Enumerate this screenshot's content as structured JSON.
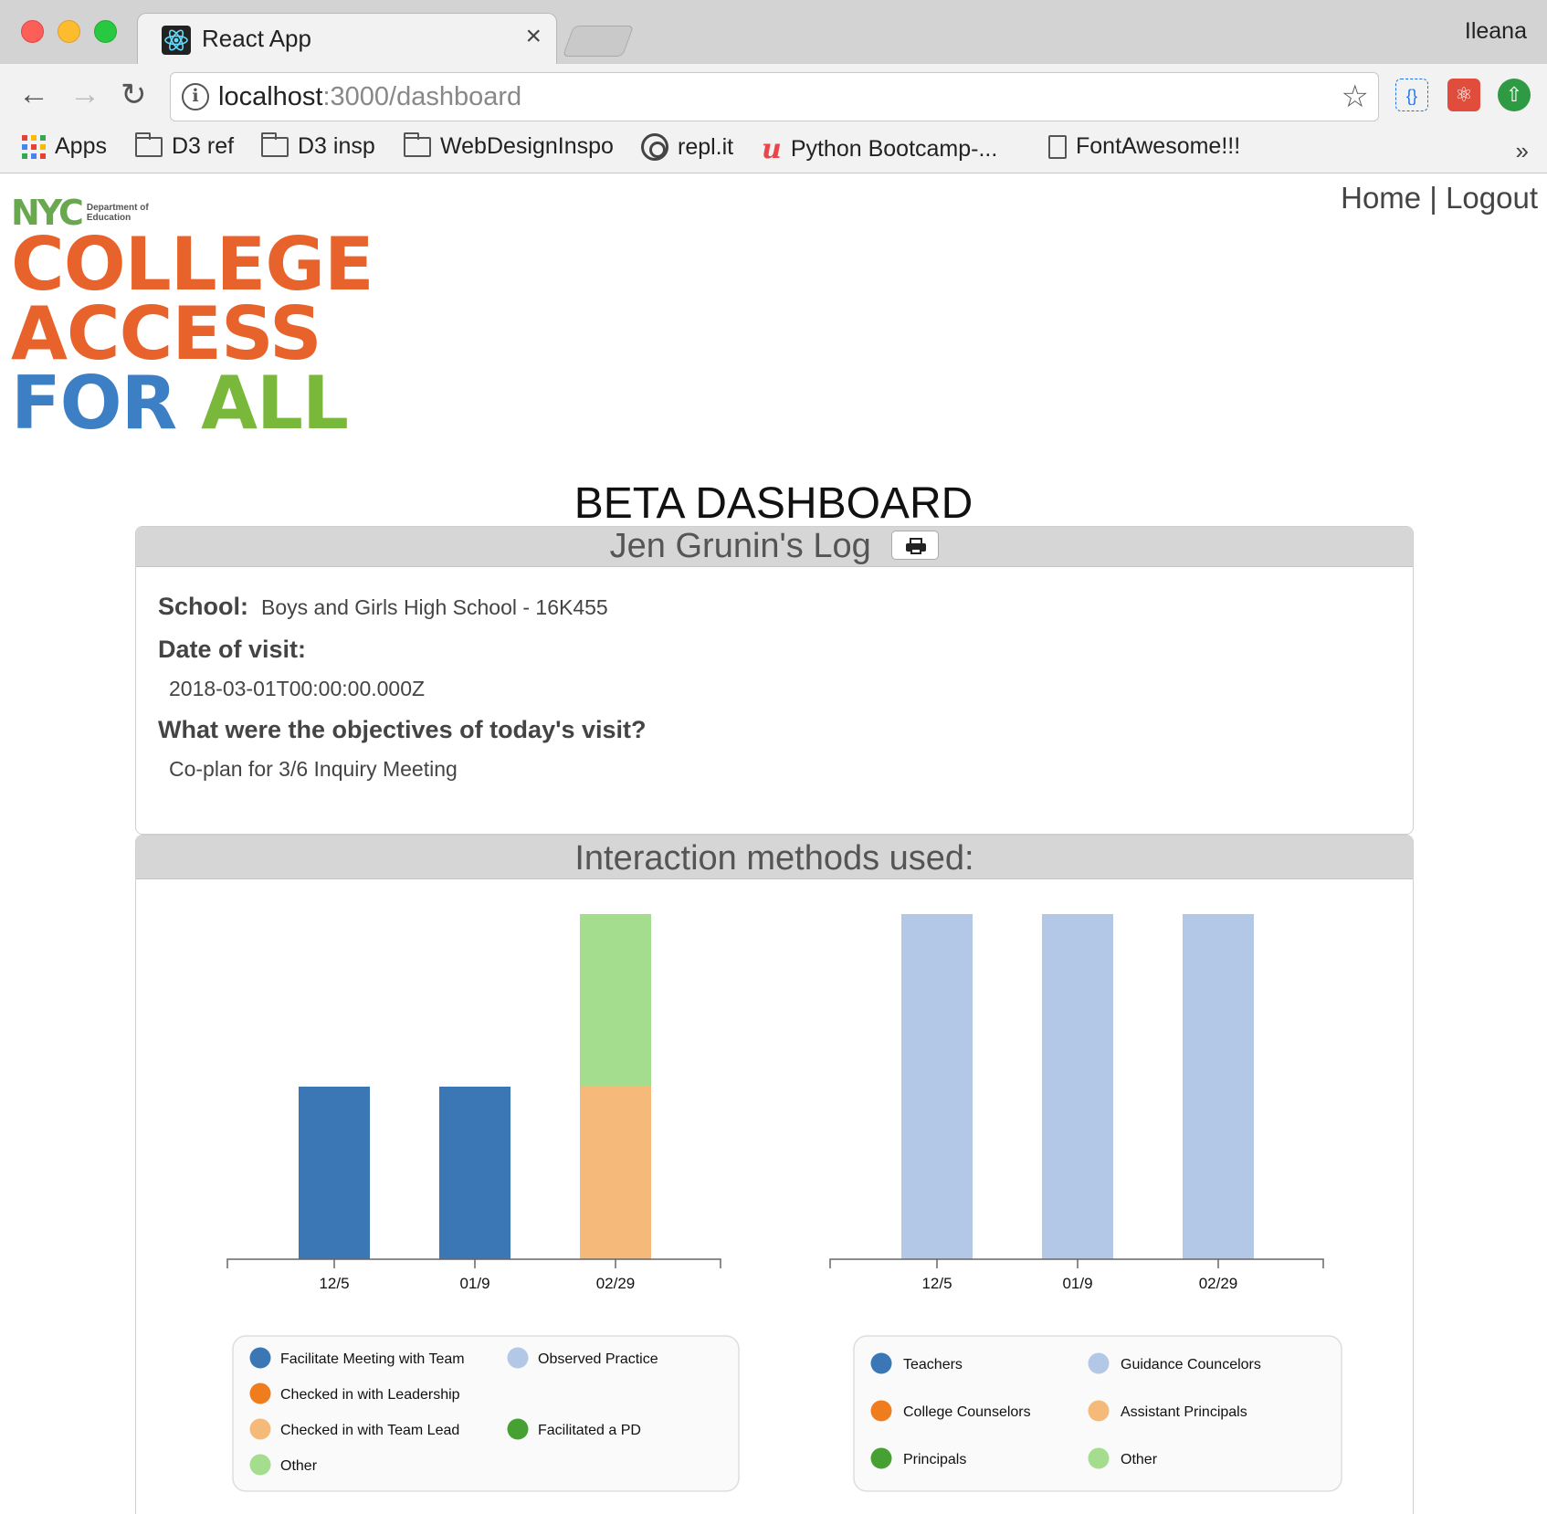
{
  "browser": {
    "tab_title": "React App",
    "tab_close": "×",
    "profile_name": "Ileana",
    "url_host": "localhost",
    "url_path": ":3000/dashboard",
    "bookmarks": [
      {
        "label": "Apps",
        "icon": "apps-grid-icon"
      },
      {
        "label": "D3 ref",
        "icon": "folder-icon"
      },
      {
        "label": "D3 insp",
        "icon": "folder-icon"
      },
      {
        "label": "WebDesignInspo",
        "icon": "folder-icon"
      },
      {
        "label": "repl.it",
        "icon": "replit-icon"
      },
      {
        "label": "Python Bootcamp-...",
        "icon": "udemy-icon"
      },
      {
        "label": "FontAwesome!!!",
        "icon": "document-icon"
      }
    ],
    "bookmarks_more": "»"
  },
  "nav": {
    "home": "Home",
    "separator": " | ",
    "logout": "Logout"
  },
  "logo": {
    "nyc": "NYC",
    "department": "Department of Education",
    "line1": "COLLEGE",
    "line2": "ACCESS",
    "line3_a": "FOR",
    "line3_b": "ALL"
  },
  "page_title": "BETA DASHBOARD",
  "log": {
    "title": "Jen Grunin's Log",
    "school_label": "School:",
    "school_value": "Boys and Girls High School - 16K455",
    "date_label": "Date of visit:",
    "date_value": "2018-03-01T00:00:00.000Z",
    "objectives_label": "What were the objectives of today's visit?",
    "objectives_value": "Co-plan for 3/6 Inquiry Meeting"
  },
  "interaction_title": "Interaction methods used:",
  "colors": {
    "dark_blue": "#3b77b4",
    "light_blue": "#b3c7e6",
    "orange": "#ef7d1e",
    "light_orange": "#f5b97a",
    "green": "#46a032",
    "light_green": "#a4dd8d"
  },
  "chart_data": [
    {
      "type": "bar",
      "stacked": true,
      "categories": [
        "12/5",
        "01/9",
        "02/29"
      ],
      "series": [
        {
          "name": "Facilitate Meeting with Team",
          "color": "#3b77b4",
          "values": [
            1,
            1,
            0
          ]
        },
        {
          "name": "Checked in with Leadership",
          "color": "#ef7d1e",
          "values": [
            0,
            0,
            0
          ]
        },
        {
          "name": "Checked in with Team Lead",
          "color": "#f5b97a",
          "values": [
            0,
            0,
            1
          ]
        },
        {
          "name": "Other",
          "color": "#a4dd8d",
          "values": [
            0,
            0,
            1
          ]
        },
        {
          "name": "Observed Practice",
          "color": "#b3c7e6",
          "values": [
            0,
            0,
            0
          ]
        },
        {
          "name": "Facilitated a PD",
          "color": "#46a032",
          "values": [
            0,
            0,
            0
          ]
        }
      ],
      "legend_layout": [
        [
          "Facilitate Meeting with Team",
          "Observed Practice"
        ],
        [
          "Checked in with Leadership"
        ],
        [
          "Checked in with Team Lead",
          "Facilitated a PD"
        ],
        [
          "Other"
        ]
      ],
      "ylim": [
        0,
        2
      ],
      "grid": false,
      "legend_placement": "bottom"
    },
    {
      "type": "bar",
      "stacked": true,
      "categories": [
        "12/5",
        "01/9",
        "02/29"
      ],
      "series": [
        {
          "name": "Teachers",
          "color": "#3b77b4",
          "values": [
            0,
            0,
            0
          ]
        },
        {
          "name": "Guidance Councelors",
          "color": "#b3c7e6",
          "values": [
            1,
            1,
            1
          ]
        },
        {
          "name": "College Counselors",
          "color": "#ef7d1e",
          "values": [
            0,
            0,
            0
          ]
        },
        {
          "name": "Assistant Principals",
          "color": "#f5b97a",
          "values": [
            0,
            0,
            0
          ]
        },
        {
          "name": "Principals",
          "color": "#46a032",
          "values": [
            0,
            0,
            0
          ]
        },
        {
          "name": "Other",
          "color": "#a4dd8d",
          "values": [
            0,
            0,
            0
          ]
        }
      ],
      "legend_layout": [
        [
          "Teachers",
          "Guidance Councelors"
        ],
        [
          "College Counselors",
          "Assistant Principals"
        ],
        [
          "Principals",
          "Other"
        ]
      ],
      "ylim": [
        0,
        1
      ],
      "grid": false,
      "legend_placement": "bottom"
    }
  ]
}
